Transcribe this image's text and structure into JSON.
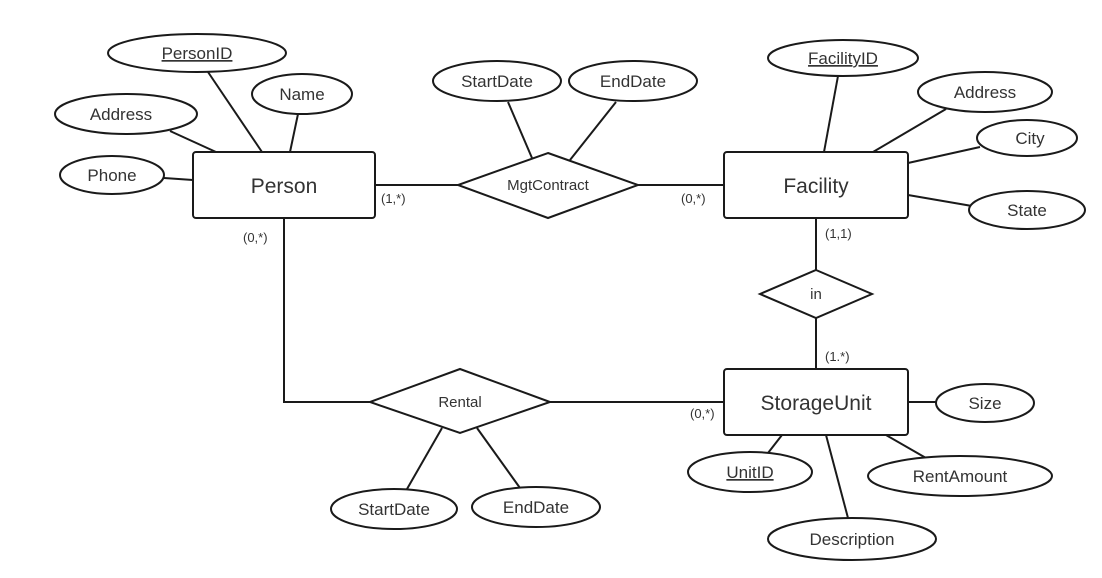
{
  "diagram": {
    "type": "entity-relationship",
    "entities": [
      {
        "id": "person",
        "label": "Person"
      },
      {
        "id": "facility",
        "label": "Facility"
      },
      {
        "id": "storageunit",
        "label": "StorageUnit"
      }
    ],
    "relationships": [
      {
        "id": "mgtcontract",
        "label": "MgtContract",
        "connects": [
          "person",
          "facility"
        ]
      },
      {
        "id": "in",
        "label": "in",
        "connects": [
          "facility",
          "storageunit"
        ]
      },
      {
        "id": "rental",
        "label": "Rental",
        "connects": [
          "person",
          "storageunit"
        ]
      }
    ],
    "attributes": [
      {
        "id": "person-personid",
        "owner": "person",
        "label": "PersonID",
        "key": true
      },
      {
        "id": "person-name",
        "owner": "person",
        "label": "Name",
        "key": false
      },
      {
        "id": "person-address",
        "owner": "person",
        "label": "Address",
        "key": false
      },
      {
        "id": "person-phone",
        "owner": "person",
        "label": "Phone",
        "key": false
      },
      {
        "id": "mgt-startdate",
        "owner": "mgtcontract",
        "label": "StartDate",
        "key": false
      },
      {
        "id": "mgt-enddate",
        "owner": "mgtcontract",
        "label": "EndDate",
        "key": false
      },
      {
        "id": "facility-facilityid",
        "owner": "facility",
        "label": "FacilityID",
        "key": true
      },
      {
        "id": "facility-address",
        "owner": "facility",
        "label": "Address",
        "key": false
      },
      {
        "id": "facility-city",
        "owner": "facility",
        "label": "City",
        "key": false
      },
      {
        "id": "facility-state",
        "owner": "facility",
        "label": "State",
        "key": false
      },
      {
        "id": "unit-size",
        "owner": "storageunit",
        "label": "Size",
        "key": false
      },
      {
        "id": "unit-unitid",
        "owner": "storageunit",
        "label": "UnitID",
        "key": true
      },
      {
        "id": "unit-description",
        "owner": "storageunit",
        "label": "Description",
        "key": false
      },
      {
        "id": "unit-rentamount",
        "owner": "storageunit",
        "label": "RentAmount",
        "key": false
      },
      {
        "id": "rental-startdate",
        "owner": "rental",
        "label": "StartDate",
        "key": false
      },
      {
        "id": "rental-enddate",
        "owner": "rental",
        "label": "EndDate",
        "key": false
      }
    ],
    "cardinalities": {
      "person_mgtcontract": "(1,*)",
      "facility_mgtcontract": "(0,*)",
      "facility_in": "(1,1)",
      "storageunit_in": "(1.*)",
      "person_rental": "(0,*)",
      "storageunit_rental": "(0,*)"
    }
  }
}
